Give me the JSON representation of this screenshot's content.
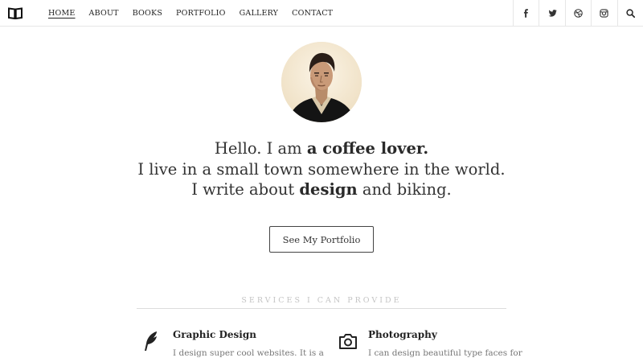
{
  "nav": {
    "items": [
      {
        "label": "HOME",
        "active": true
      },
      {
        "label": "ABOUT",
        "active": false
      },
      {
        "label": "BOOKS",
        "active": false
      },
      {
        "label": "PORTFOLIO",
        "active": false
      },
      {
        "label": "GALLERY",
        "active": false
      },
      {
        "label": "CONTACT",
        "active": false
      }
    ]
  },
  "social": [
    "facebook-icon",
    "twitter-icon",
    "dribbble-icon",
    "instagram-icon",
    "search-icon"
  ],
  "hero": {
    "line1_a": "Hello. I am ",
    "line1_b": "a coffee lover.",
    "line2": "I live in a small town somewhere in the world.",
    "line3_a": "I write about ",
    "line3_b": "design",
    "line3_c": " and biking."
  },
  "cta": {
    "label": "See My Portfolio"
  },
  "services": {
    "title": "SERVICES I CAN PROVIDE",
    "items": [
      {
        "title": "Graphic Design",
        "text": "I design super cool websites. It is a",
        "icon": "feather-icon"
      },
      {
        "title": "Photography",
        "text": "I can design beautiful type faces for",
        "icon": "camera-icon"
      }
    ]
  }
}
